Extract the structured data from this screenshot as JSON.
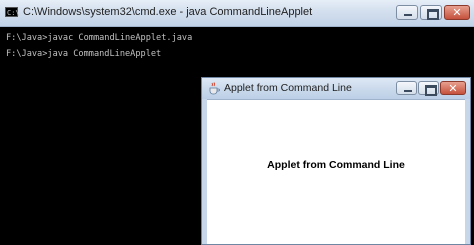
{
  "cmd_window": {
    "title": "C:\\Windows\\system32\\cmd.exe - java  CommandLineApplet",
    "icon_label": "C:\\",
    "lines": [
      "F:\\Java>javac CommandLineApplet.java",
      "F:\\Java>java CommandLineApplet"
    ],
    "controls": {
      "minimize": "",
      "maximize": "",
      "close": "✕"
    }
  },
  "applet_window": {
    "title": "Applet from Command Line",
    "content_text": "Applet from Command Line",
    "controls": {
      "minimize": "",
      "maximize": "",
      "close": "✕"
    }
  },
  "colors": {
    "console_bg": "#000000",
    "console_text": "#c0c0c0",
    "close_button": "#c4513c"
  }
}
